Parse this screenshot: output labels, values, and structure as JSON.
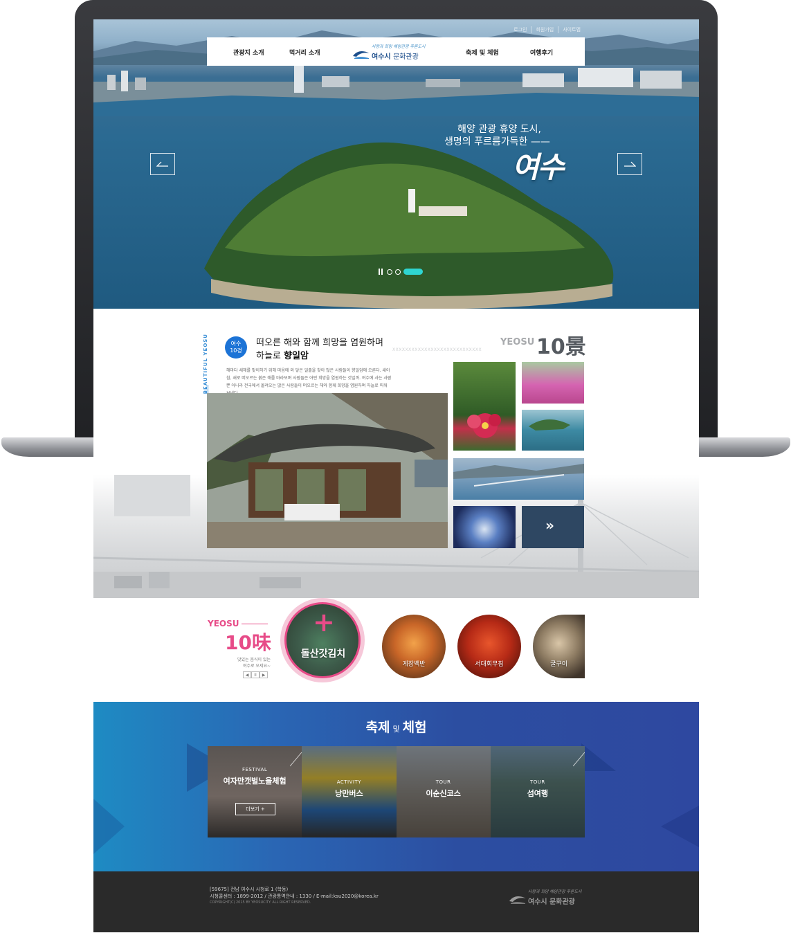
{
  "top_links": [
    "로그인",
    "회원가입",
    "사이트맵"
  ],
  "gnb": {
    "menu": [
      "관광지 소개",
      "먹거리 소개",
      "축제 및 체험",
      "여행후기"
    ],
    "logo_slogan": "사랑과 희망 해양관광 푸른도시",
    "logo_name": "여수시",
    "logo_sub": "문화관광"
  },
  "hero": {
    "line1": "해양 관광 휴양 도시,",
    "line2": "생명의 푸르름가득한 ——",
    "brand": "여수",
    "colors": {
      "indicator_active": "#2fd5d2"
    }
  },
  "ten_scenery": {
    "vertical_label": "BEAUTIFUL YEOSU",
    "badge_line1": "여수",
    "badge_line2": "10경",
    "title_line1": "떠오른 해와 함께 희망을 염원하며",
    "title_prefix": "하늘로 ",
    "title_bold": "향일암",
    "desc": "해마다 새해를 맞이하기 위해 마음에 와 닿은 일출을 찾아 많은 사람들이 향일암에 오른다. 새아침, 새로 떠오르는 붉은 해를 바라보며 사람들은 어떤 희망을 염원하는 것일까. 여수에 사는 사람뿐 아니라 전국에서 몰려오는 많은 사람들이 떠오르는 해와 함께 희망을 염원하며 하늘로 띄워 보낸다",
    "en": "YEOSU",
    "kr": "10景",
    "xline": "XXXXXXXXXXXXXXXXXXXXXXXXXXXX",
    "next_label": "»"
  },
  "food": {
    "en": "YEOSU",
    "kr": "10味",
    "sub1": "맛있는 음식이 있는",
    "sub2": "여수로 오세요~",
    "pager": [
      "◀",
      "II",
      "▶"
    ],
    "active": {
      "plus": "+",
      "label": "돌산갓김치"
    },
    "items": [
      "게장백반",
      "서대회무침",
      "굴구이"
    ],
    "accent": "#e74b88"
  },
  "festival": {
    "title_a": "축제",
    "title_b": "및",
    "title_c": "체험",
    "cards": [
      {
        "tag": "FESTIVAL",
        "name": "여자만갯벌노을체험",
        "more": "더보기 +"
      },
      {
        "tag": "ACTIVITY",
        "name": "낭만버스"
      },
      {
        "tag": "TOUR",
        "name": "이순신코스"
      },
      {
        "tag": "TOUR",
        "name": "섬여행"
      }
    ]
  },
  "footer": {
    "addr1": "[59675] 전남 여수시 시청로 1 (학동)",
    "addr2": "시청콜센터 : 1899-2012 / 관광통역안내 : 1330 / E-mail:ksu2020@korea.kr",
    "copy": "COPYRIGHT(C) 2015 BY YEOSUCITY. ALL RIGHT RESERVED.",
    "logo_slogan": "사랑과 희망 해양관광 푸른도시",
    "logo_name": "여수시 문화관광"
  }
}
